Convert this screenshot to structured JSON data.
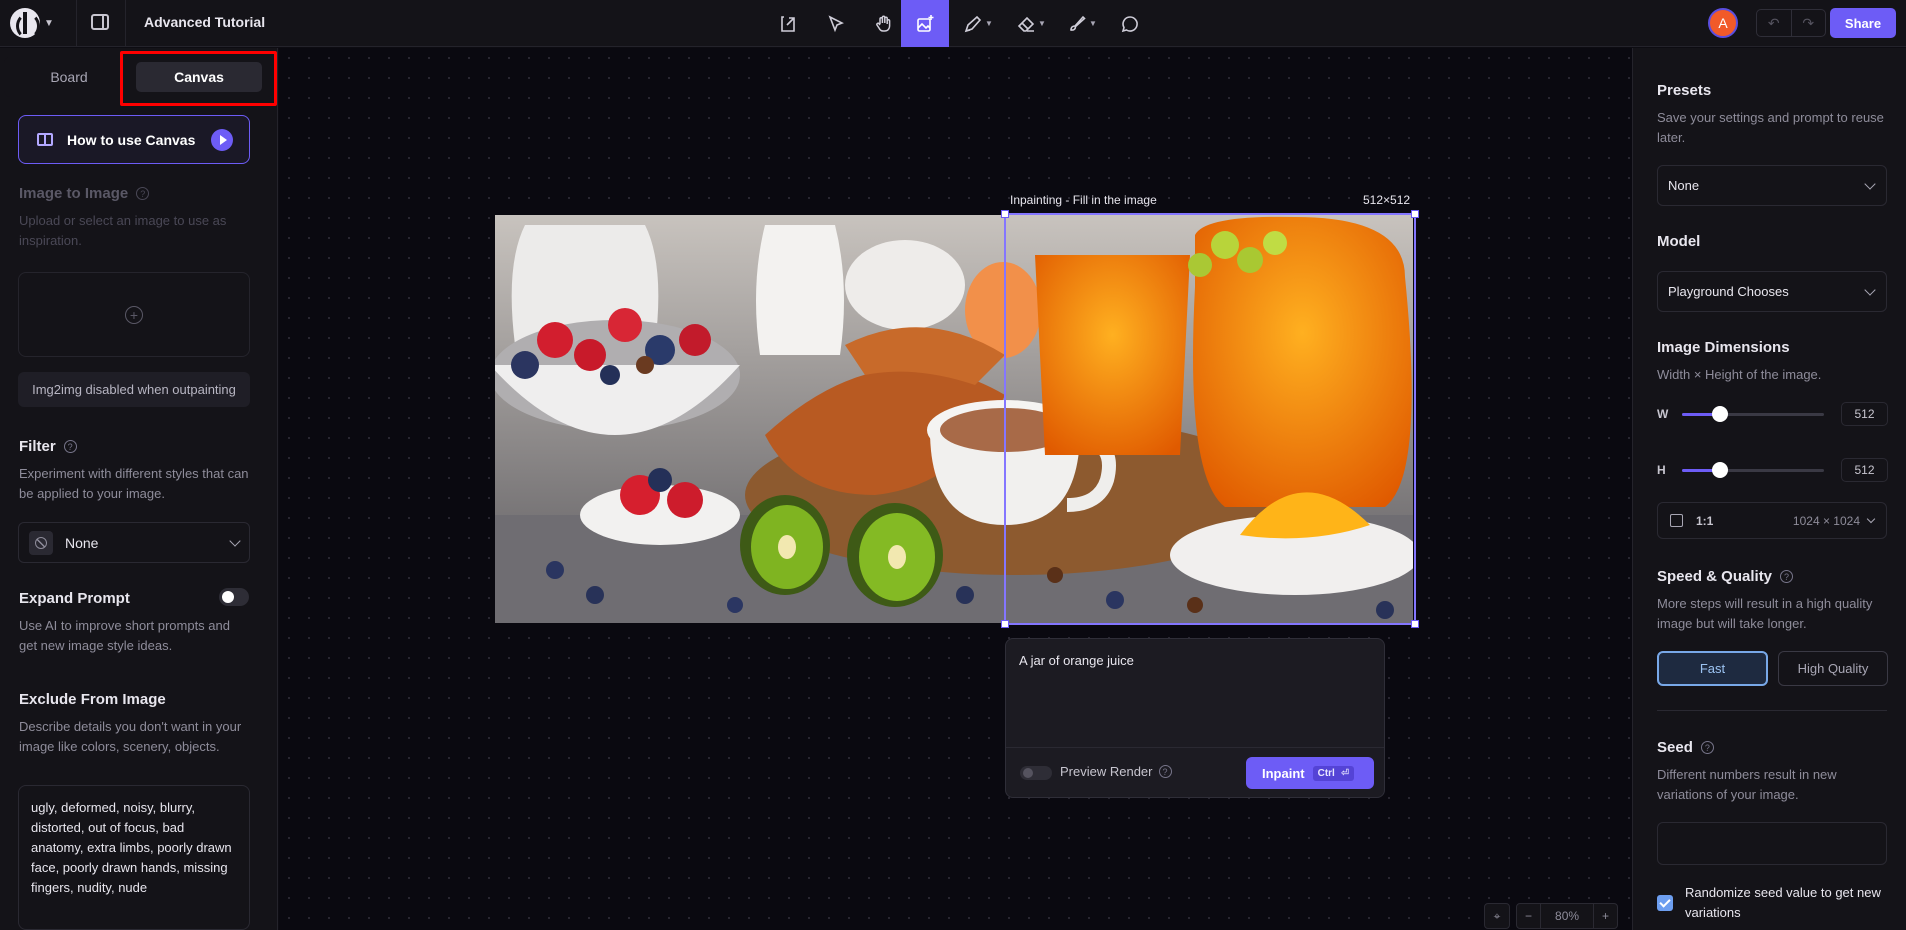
{
  "header": {
    "title": "Advanced Tutorial",
    "avatar_letter": "A",
    "share_label": "Share",
    "tools": [
      "upload-icon",
      "select-icon",
      "hand-icon",
      "generate-image-icon",
      "pencil-icon",
      "eraser-icon",
      "brush-icon",
      "comment-icon"
    ],
    "active_tool": "generate-image-icon",
    "accent": "#6d5cf6"
  },
  "left": {
    "tabs": {
      "board": "Board",
      "canvas": "Canvas"
    },
    "how_to_label": "How to use Canvas",
    "img2img": {
      "title": "Image to Image",
      "desc": "Upload or select an image to use as inspiration.",
      "disabled_note": "Img2img disabled when outpainting"
    },
    "filter": {
      "title": "Filter",
      "desc": "Experiment with different styles that can be applied to your image.",
      "value": "None"
    },
    "expand_prompt": {
      "title": "Expand Prompt",
      "desc": "Use AI to improve short prompts and get new image style ideas."
    },
    "exclude": {
      "title": "Exclude From Image",
      "desc": "Describe details you don't want in your image like colors, scenery, objects.",
      "value": "ugly, deformed, noisy, blurry, distorted, out of focus, bad anatomy, extra limbs, poorly drawn face, poorly drawn hands, missing fingers, nudity, nude"
    }
  },
  "canvas": {
    "frame_label": "Inpainting - Fill in the image",
    "frame_size": "512×512",
    "prompt": "A jar of orange juice",
    "preview_label": "Preview Render",
    "inpaint_label": "Inpaint",
    "inpaint_kbd": "Ctrl",
    "inpaint_kbd_symbol": "⏎",
    "zoom": "80%",
    "zoom_minus": "−",
    "zoom_plus": "+"
  },
  "right": {
    "presets": {
      "title": "Presets",
      "desc": "Save your settings and prompt to reuse later.",
      "value": "None"
    },
    "model": {
      "title": "Model",
      "value": "Playground Chooses"
    },
    "dimensions": {
      "title": "Image Dimensions",
      "desc": "Width × Height of the image.",
      "w_label": "W",
      "w_value": "512",
      "h_label": "H",
      "h_value": "512",
      "ratio": "1:1",
      "ratio_size": "1024 × 1024",
      "w_fraction": 0.27,
      "h_fraction": 0.27
    },
    "speed": {
      "title": "Speed & Quality",
      "desc": "More steps will result in a high quality image but will take longer.",
      "fast_label": "Fast",
      "high_label": "High Quality",
      "selected": "Fast"
    },
    "seed": {
      "title": "Seed",
      "desc": "Different numbers result in new variations of your image.",
      "randomize_label": "Randomize seed value to get new variations",
      "randomize_checked": true
    }
  }
}
